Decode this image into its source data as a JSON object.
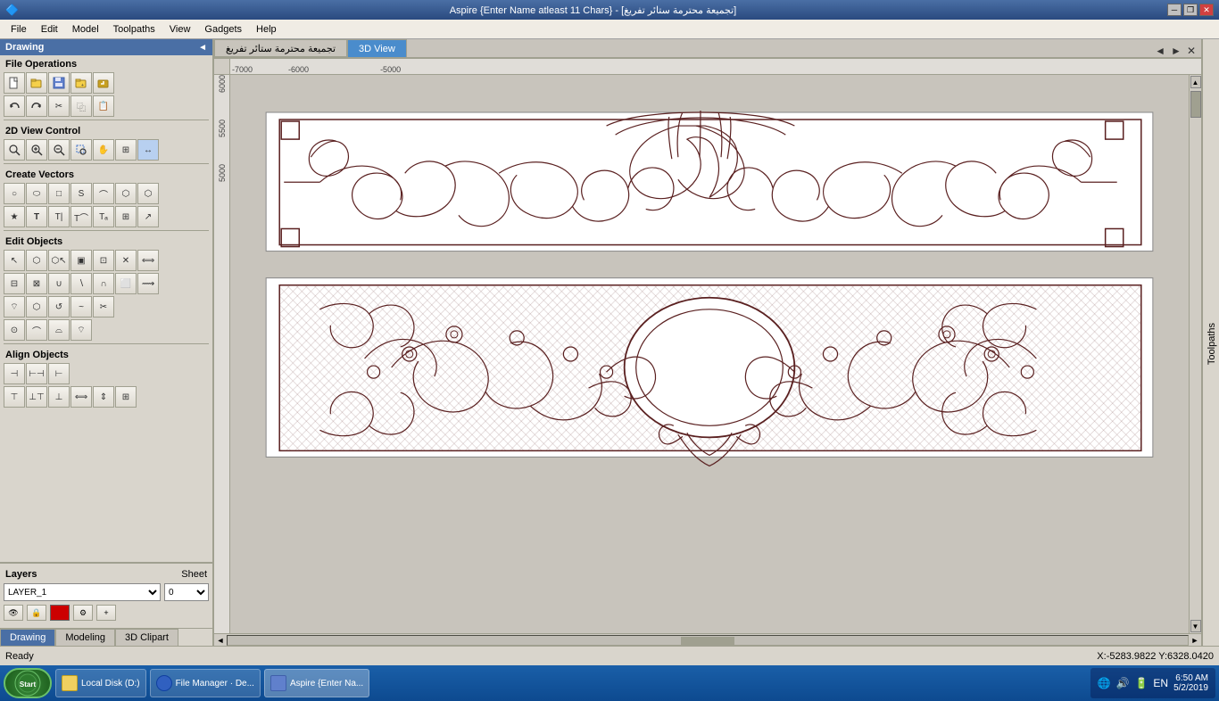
{
  "titlebar": {
    "title": "Aspire {Enter Name atleast 11 Chars} - [تجميعة محترمة ستائر تفريغ]",
    "arabic_title": "تجميعة محترمة ستائر تفريغ",
    "controls": [
      "minimize",
      "restore",
      "close"
    ]
  },
  "menubar": {
    "items": [
      "File",
      "Edit",
      "Model",
      "Toolpaths",
      "View",
      "Gadgets",
      "Help"
    ]
  },
  "left_panel": {
    "header": "Drawing",
    "sections": {
      "file_ops": "File Operations",
      "view_control": "2D View Control",
      "create_vectors": "Create Vectors",
      "edit_objects": "Edit Objects",
      "align_objects": "Align Objects"
    },
    "layers": {
      "label": "Layers",
      "sheet_label": "Sheet",
      "layer_name": "LAYER_1",
      "sheet_number": "0"
    }
  },
  "tabs": {
    "drawing_tab": "Drawing",
    "modeling_tab": "Modeling",
    "clipart_tab": "3D Clipart"
  },
  "canvas": {
    "tabs": [
      {
        "label": "تجميعة محترمة ستائر تفريغ",
        "active": false
      },
      {
        "label": "3D View",
        "active": true
      }
    ],
    "rulers": {
      "top_marks": [
        "-7000",
        "-6000",
        "-5000"
      ],
      "left_marks": [
        "6000",
        "5500",
        "5000"
      ]
    }
  },
  "right_panel": {
    "label": "Toolpaths"
  },
  "statusbar": {
    "status": "Ready",
    "coords": "X:-5283.9822 Y:6328.0420"
  },
  "taskbar": {
    "start_label": "Start",
    "items": [
      {
        "label": "Local Disk (D:)",
        "icon": "folder"
      },
      {
        "label": "File Manager · De...",
        "icon": "browser"
      },
      {
        "label": "Aspire {Enter Na...",
        "icon": "aspire",
        "active": true
      }
    ],
    "clock": "6:50 AM\n5/2/2019",
    "sys_icons": [
      "network",
      "volume",
      "battery"
    ]
  }
}
